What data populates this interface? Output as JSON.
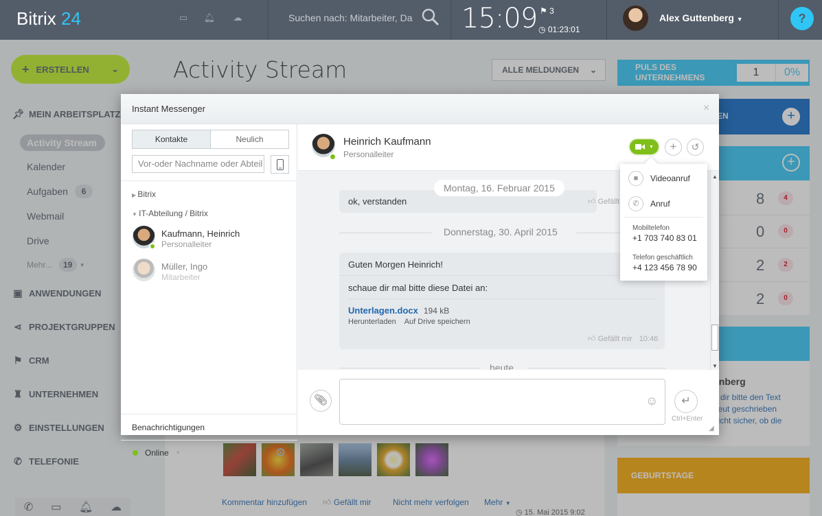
{
  "app": {
    "logo_main": "Bitrix",
    "logo_num": "24"
  },
  "topbar": {
    "search_placeholder": "Suchen nach: Mitarbeiter, Da",
    "clock": "15:09",
    "flag_count": "3",
    "timer": "01:23:01",
    "user": "Alex Guttenberg",
    "help": "?"
  },
  "sidebar": {
    "create_label": "ERSTELLEN",
    "section_workspace": "MEIN ARBEITSPLATZ",
    "items": [
      {
        "label": "Activity Stream"
      },
      {
        "label": "Kalender"
      },
      {
        "label": "Aufgaben",
        "badge": "6"
      },
      {
        "label": "Webmail"
      },
      {
        "label": "Drive"
      },
      {
        "label": "Mehr...",
        "badge": "19"
      }
    ],
    "sections": [
      "ANWENDUNGEN",
      "PROJEKTGRUPPEN",
      "CRM",
      "UNTERNEHMEN",
      "EINSTELLUNGEN",
      "TELEFONIE"
    ]
  },
  "main": {
    "title": "Activity Stream",
    "filter": "ALLE MELDUNGEN",
    "feed_actions": [
      "Kommentar hinzufügen",
      "Gefällt mir",
      "Nicht mehr verfolgen",
      "Mehr"
    ],
    "feed_date": "15. Mai 2015 9:02"
  },
  "right": {
    "puls_title": "PULS DES UNTERNEHMENS",
    "puls_value": "1",
    "puls_percent": "0%",
    "block1_fragment": "EN",
    "rows": [
      {
        "num": "8",
        "badge": "4"
      },
      {
        "num": "0",
        "badge": "0"
      },
      {
        "num": "2",
        "badge": "2"
      },
      {
        "num": "2",
        "badge": "0"
      }
    ],
    "note_name": "enberg",
    "note_lines": [
      "n dir bitte den Text",
      "neut geschrieben",
      "nicht sicher, ob die"
    ],
    "birthdays": "GEBURTSTAGE"
  },
  "messenger": {
    "title": "Instant Messenger",
    "close": "×",
    "tabs": [
      "Kontakte",
      "Neulich"
    ],
    "search_placeholder": "Vor-oder Nachname oder Abteil",
    "groups": [
      "Bitrix",
      "IT-Abteilung / Bitrix"
    ],
    "contacts": [
      {
        "name": "Kaufmann, Heinrich",
        "role": "Personalleiter",
        "online": true
      },
      {
        "name": "Müller, Ingo",
        "role": "Mitarbeiter",
        "online": false
      }
    ],
    "notifications": "Benachrichtigungen",
    "status": "Online",
    "chat": {
      "name": "Heinrich Kaufmann",
      "role": "Personalleiter",
      "date1": "Montag, 16. Februar 2015",
      "msg1": "ok, verstanden",
      "like1": "Gefällt",
      "date2": "Donnerstag, 30. April 2015",
      "msg2a": "Guten Morgen Heinrich!",
      "msg2b": "schaue dir mal bitte diese Datei an:",
      "file_name": "Unterlagen.docx",
      "file_size": "194 kB",
      "file_download": "Herunterladen",
      "file_save": "Auf Drive speichern",
      "like2": "Gefällt mir",
      "time2": "10:46",
      "date3": "heute",
      "send_hint": "Ctrl+Enter"
    },
    "call_menu": {
      "video": "Videoanruf",
      "call": "Anruf",
      "mobile_label": "Mobiltelefon",
      "mobile": "+1 703 740 83 01",
      "work_label": "Telefon geschäftlich",
      "work": "+4 123 456 78 90"
    }
  },
  "colors": {
    "accent": "#2fc6f6",
    "create": "#bbed21",
    "video": "#7fbf19",
    "topbar": "#535c69",
    "birthday": "#f7a700"
  }
}
